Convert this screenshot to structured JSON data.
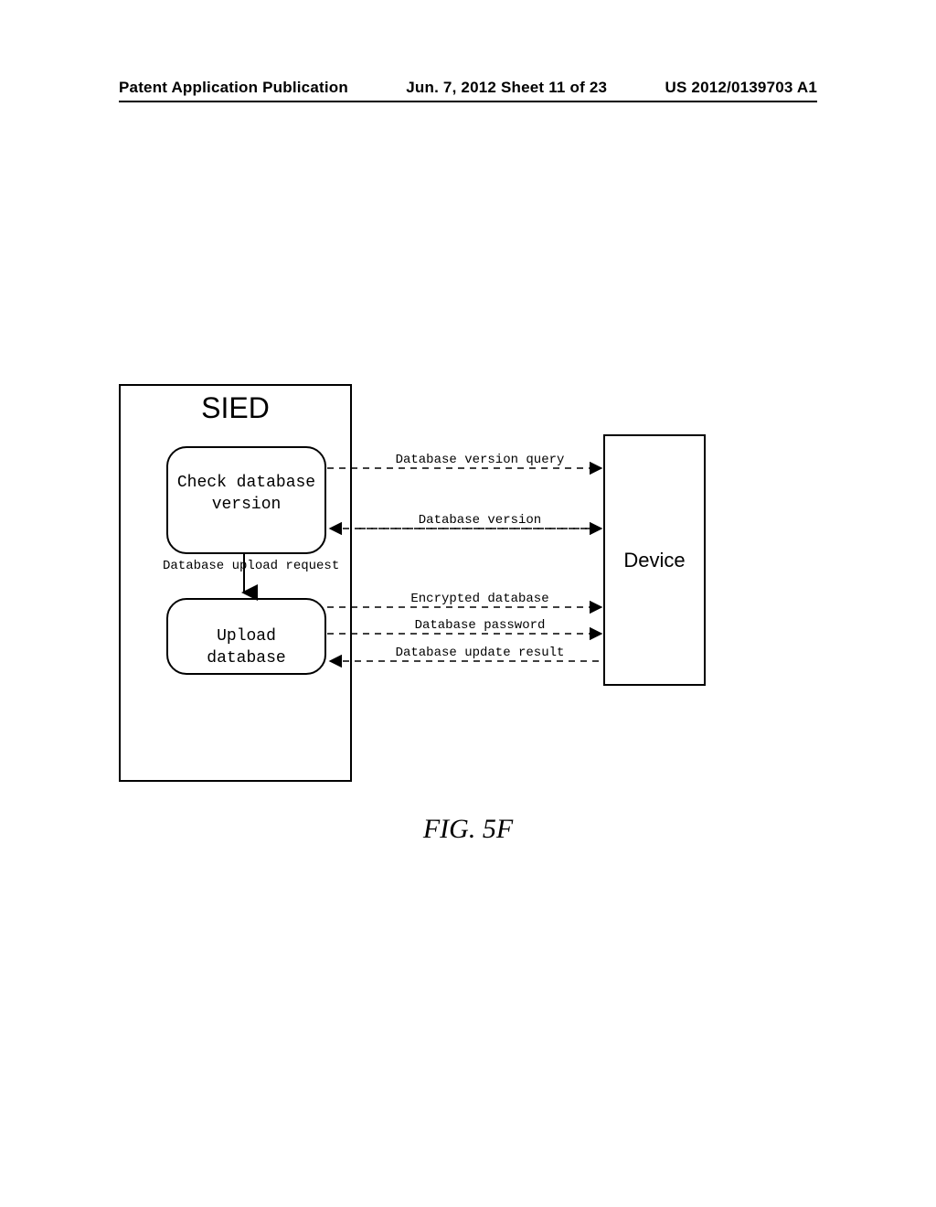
{
  "header": {
    "left": "Patent Application Publication",
    "center": "Jun. 7, 2012  Sheet 11 of 23",
    "right": "US 2012/0139703 A1"
  },
  "sied": {
    "title": "SIED",
    "state_check": "Check database version",
    "state_upload": "Upload database",
    "transition": "Database upload request"
  },
  "device": {
    "label": "Device"
  },
  "messages": {
    "m1": "Database version query",
    "m2": "Database version",
    "m3": "Encrypted database",
    "m4": "Database password",
    "m5": "Database update result"
  },
  "figure": {
    "label": "FIG. 5F"
  }
}
